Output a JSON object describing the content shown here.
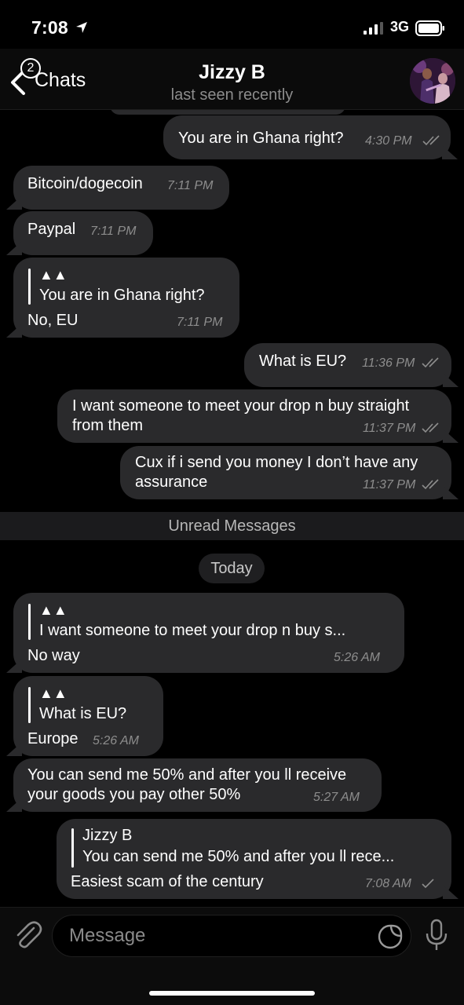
{
  "status_bar": {
    "time": "7:08",
    "network": "3G"
  },
  "nav": {
    "back_badge": "2",
    "back_label": "Chats",
    "title": "Jizzy B",
    "subtitle": "last seen recently"
  },
  "messages": [
    {
      "text": "You are in Ghana right?",
      "time": "4:30 PM"
    },
    {
      "text": "Bitcoin/dogecoin",
      "time": "7:11 PM"
    },
    {
      "text": "Paypal",
      "time": "7:11 PM"
    },
    {
      "reply_name": "▲▲",
      "reply_text": "You are in Ghana right?",
      "text": "No, EU",
      "time": "7:11 PM"
    },
    {
      "text": "What is EU?",
      "time": "11:36 PM"
    },
    {
      "lines": [
        "I want someone to meet your drop n buy straight",
        "from them"
      ],
      "time": "11:37 PM"
    },
    {
      "lines": [
        "Cux if i send you money I don’t have any",
        "assurance"
      ],
      "time": "11:37 PM"
    },
    {
      "reply_name": "▲▲",
      "reply_text": "I want someone to meet your drop n buy s...",
      "text": "No way",
      "time": "5:26 AM"
    },
    {
      "reply_name": "▲▲",
      "reply_text": "What is EU?",
      "text": "Europe",
      "time": "5:26 AM"
    },
    {
      "lines": [
        "You can send me 50% and after you ll receive",
        "your goods you pay other 50%"
      ],
      "time": "5:27 AM"
    },
    {
      "reply_name": "Jizzy B",
      "reply_text": "You can send me 50% and after you ll rece...",
      "text": "Easiest scam of the century",
      "time": "7:08 AM"
    }
  ],
  "unread_label": "Unread Messages",
  "date_label": "Today",
  "input": {
    "placeholder": "Message"
  },
  "colors": {
    "background": "#000000",
    "bubble": "#2a2a2c",
    "time": "#8d8d8d"
  },
  "icons": [
    "location-arrow-icon",
    "signal-icon",
    "battery-icon",
    "chevron-left-icon",
    "attach-icon",
    "sticker-icon",
    "mic-icon"
  ]
}
